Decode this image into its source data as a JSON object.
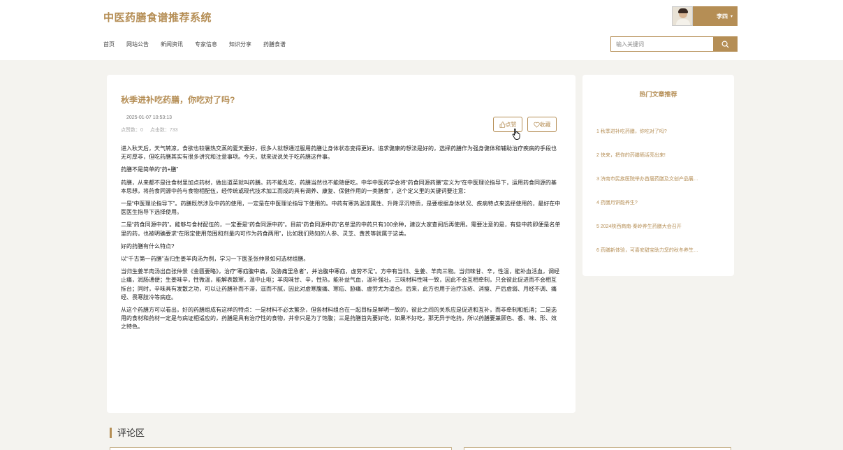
{
  "site": {
    "title": "中医药膳食谱推荐系统"
  },
  "nav": [
    "首页",
    "网站公告",
    "新闻资讯",
    "专家信息",
    "知识分享",
    "药膳食谱"
  ],
  "user": {
    "name": "李四",
    "caret": "▾"
  },
  "search": {
    "placeholder": "输入关键词"
  },
  "article": {
    "title": "秋季进补吃药膳，你吃对了吗?",
    "date": "2025-01-07 10:53:13",
    "likes": "点赞数：0",
    "clicks": "点击数：733",
    "like_label": "点赞",
    "fav_label": "收藏",
    "paragraphs": [
      "进入秋天后，天气转凉，食欲也较暑热交蒸的夏天要好，很多人就想通过服用药膳让身体状态变得更好。追求健康的想法是好的，选择药膳作为强身健体和辅助治疗疾病的手段也无可厚非，但吃药膳其实有很多讲究和注意事项。今天，就来说说关于吃药膳这件事。",
      "药膳不是简单的“药+膳”",
      "药膳，从来都不是往食材里加点药材，做出道菜就叫药膳。药不能乱吃，药膳当然也不能随便吃。中华中医药学会将“药食同源药膳”定义为“在中医理论指导下，运用药食同源的基本思想，将药食同源中药与食物相配伍，经传统或现代技术加工而成的具有调养、康复、保健作用的一类膳食”，这个定义里的关键词要注意：",
      "一是“中医理论指导下”。药膳既然涉及中药的使用，一定是在中医理论指导下使用的。中药有寒热温凉属性、升降浮沉特质，是要根据身体状况、疾病特点来选择使用的，最好在中医医生指导下选择使用。",
      "二是“药食同源中药”。能够与食材配伍的，一定要是“药食同源中药”。目前“药食同源中药”名单里的中药只有100余种，建议大家查阅后再使用。需要注意的是，有些中药即便是名单里的药，也被明确要求“在限定使用范围和剂量内可作为药食两用”，比如我们熟知的人参、灵芝、黄芪等就属于这类。",
      "好的药膳有什么特点?",
      "以“千古第一药膳”当归生姜羊肉汤为例，学习一下医圣张仲景如何选材组膳。",
      "当归生姜羊肉汤出自张仲景《金匮要略》，治疗“寒疝腹中痛，及胁痛里急者”，并治腹中寒疝，虚劳不足”。方中有当归、生姜、羊肉三物。当归味甘、辛，性温，能补血活血，调经止痛，润肠通便；生姜味辛，性微温，能解表散寒，温中止呕；羊肉味甘、辛，性热，能补益气血，温补强壮。三味材料性味一致，因此不会互相牵制，只会彼此促进而不会相互拆台；同时，辛味具有发散之功，可以让药膳补而不滞，滋而不腻，因此对虚寒腹痛、寒疝、胁痛、虚劳尤为适合。后来，此方也用于治疗冻疮、消瘦、产后虚弱、月经不调、痛经、畏寒肢冷等病症。",
      "从这个药膳方可以看出，好的药膳组成有这样的特点：一是材料不必太繁杂，但各材料组合在一起目标是鲜明一致的，彼此之间的关系应是促进和互补，而非牵制和抵消；二是选用的食材和药材一定是与病证相适应的，药膳是具有治疗性的食物，并非只是为了饱腹；三是药膳首先要好吃，如果不好吃，那无异于吃药，所以药膳要兼顾色、香、味、形、效之特色。"
    ]
  },
  "hot": {
    "title": "热门文章推荐",
    "items": [
      "1 秋季进补吃药膳，你吃对了吗?",
      "2 快来，把你的药膳晒活亮出来!",
      "3 济南市民族医院举办首届药膳及文创产品展…",
      "4 药膳月饼能养生?",
      "5 2024陕西商南·秦岭养生药膳大会召开",
      "6 药膳新体验，可喜安甜宝助力您的秋冬养生…"
    ]
  },
  "comments": {
    "title": "评论区"
  },
  "colors": {
    "accent": "#b58e55",
    "background": "#f4f3ef"
  },
  "icons": [
    "search-icon",
    "thumbs-up-icon",
    "heart-icon",
    "hand-cursor-icon",
    "user-avatar"
  ]
}
